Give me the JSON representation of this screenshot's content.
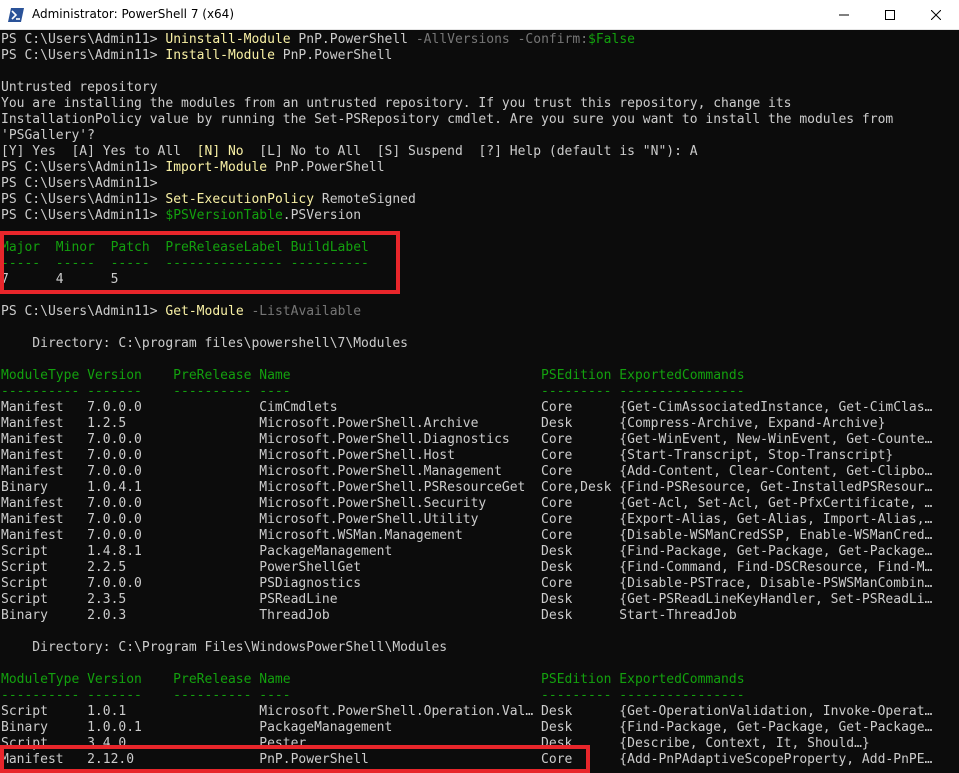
{
  "window": {
    "title": "Administrator: PowerShell 7 (x64)"
  },
  "colors": {
    "background": "#0c0c0c",
    "text": "#cccccc",
    "command": "#f9f1a5",
    "header": "#13a10e",
    "parameter": "#767676",
    "highlight_box": "#e8262b"
  },
  "terminal": {
    "lines": [
      [
        {
          "t": "PS C:\\Users\\Admin11> ",
          "c": "w"
        },
        {
          "t": "Uninstall-Module",
          "c": "y"
        },
        {
          "t": " PnP.PowerShell ",
          "c": "w"
        },
        {
          "t": "-AllVersions -Confirm:",
          "c": "d"
        },
        {
          "t": "$False",
          "c": "g"
        }
      ],
      [
        {
          "t": "PS C:\\Users\\Admin11> ",
          "c": "w"
        },
        {
          "t": "Install-Module",
          "c": "y"
        },
        {
          "t": " PnP.PowerShell",
          "c": "w"
        }
      ],
      [],
      [
        {
          "t": "Untrusted repository",
          "c": "w"
        }
      ],
      [
        {
          "t": "You are installing the modules from an untrusted repository. If you trust this repository, change its",
          "c": "w"
        }
      ],
      [
        {
          "t": "InstallationPolicy value by running the Set-PSRepository cmdlet. Are you sure you want to install the modules from",
          "c": "w"
        }
      ],
      [
        {
          "t": "'PSGallery'?",
          "c": "w"
        }
      ],
      [
        {
          "t": "[Y] Yes  [A] Yes to All  ",
          "c": "w"
        },
        {
          "t": "[N] No",
          "c": "y"
        },
        {
          "t": "  [L] No to All  [S] Suspend  [?] Help (default is \"N\"): A",
          "c": "w"
        }
      ],
      [
        {
          "t": "PS C:\\Users\\Admin11> ",
          "c": "w"
        },
        {
          "t": "Import-Module",
          "c": "y"
        },
        {
          "t": " PnP.PowerShell",
          "c": "w"
        }
      ],
      [
        {
          "t": "PS C:\\Users\\Admin11>",
          "c": "w"
        }
      ],
      [
        {
          "t": "PS C:\\Users\\Admin11> ",
          "c": "w"
        },
        {
          "t": "Set-ExecutionPolicy",
          "c": "y"
        },
        {
          "t": " RemoteSigned",
          "c": "w"
        }
      ],
      [
        {
          "t": "PS C:\\Users\\Admin11> ",
          "c": "w"
        },
        {
          "t": "$PSVersionTable",
          "c": "g"
        },
        {
          "t": ".PSVersion",
          "c": "w"
        }
      ],
      [],
      [
        {
          "t": "Major  Minor  Patch  PreReleaseLabel BuildLabel",
          "c": "g"
        }
      ],
      [
        {
          "t": "-----  -----  -----  --------------- ----------",
          "c": "g"
        }
      ],
      [
        {
          "t": "7      4      5",
          "c": "w"
        }
      ],
      [],
      [
        {
          "t": "PS C:\\Users\\Admin11> ",
          "c": "w"
        },
        {
          "t": "Get-Module",
          "c": "y"
        },
        {
          "t": " -ListAvailable",
          "c": "d"
        }
      ],
      [],
      [
        {
          "t": "    Directory: C:\\program files\\powershell\\7\\Modules",
          "c": "w"
        }
      ],
      [],
      [
        {
          "t": "ModuleType Version    PreRelease Name                                PSEdition ExportedCommands",
          "c": "g"
        }
      ],
      [
        {
          "t": "---------- -------    ---------- ----                                --------- ----------------",
          "c": "g"
        }
      ],
      [
        {
          "t": "Manifest   7.0.0.0               CimCmdlets                          Core      {Get-CimAssociatedInstance, Get-CimClas…",
          "c": "w"
        }
      ],
      [
        {
          "t": "Manifest   1.2.5                 Microsoft.PowerShell.Archive        Desk      {Compress-Archive, Expand-Archive}",
          "c": "w"
        }
      ],
      [
        {
          "t": "Manifest   7.0.0.0               Microsoft.PowerShell.Diagnostics    Core      {Get-WinEvent, New-WinEvent, Get-Counte…",
          "c": "w"
        }
      ],
      [
        {
          "t": "Manifest   7.0.0.0               Microsoft.PowerShell.Host           Core      {Start-Transcript, Stop-Transcript}",
          "c": "w"
        }
      ],
      [
        {
          "t": "Manifest   7.0.0.0               Microsoft.PowerShell.Management     Core      {Add-Content, Clear-Content, Get-Clipbo…",
          "c": "w"
        }
      ],
      [
        {
          "t": "Binary     1.0.4.1               Microsoft.PowerShell.PSResourceGet  Core,Desk {Find-PSResource, Get-InstalledPSResour…",
          "c": "w"
        }
      ],
      [
        {
          "t": "Manifest   7.0.0.0               Microsoft.PowerShell.Security       Core      {Get-Acl, Set-Acl, Get-PfxCertificate, …",
          "c": "w"
        }
      ],
      [
        {
          "t": "Manifest   7.0.0.0               Microsoft.PowerShell.Utility        Core      {Export-Alias, Get-Alias, Import-Alias,…",
          "c": "w"
        }
      ],
      [
        {
          "t": "Manifest   7.0.0.0               Microsoft.WSMan.Management          Core      {Disable-WSManCredSSP, Enable-WSManCred…",
          "c": "w"
        }
      ],
      [
        {
          "t": "Script     1.4.8.1               PackageManagement                   Desk      {Find-Package, Get-Package, Get-Package…",
          "c": "w"
        }
      ],
      [
        {
          "t": "Script     2.2.5                 PowerShellGet                       Desk      {Find-Command, Find-DSCResource, Find-M…",
          "c": "w"
        }
      ],
      [
        {
          "t": "Script     7.0.0.0               PSDiagnostics                       Core      {Disable-PSTrace, Disable-PSWSManCombin…",
          "c": "w"
        }
      ],
      [
        {
          "t": "Script     2.3.5                 PSReadLine                          Desk      {Get-PSReadLineKeyHandler, Set-PSReadLi…",
          "c": "w"
        }
      ],
      [
        {
          "t": "Binary     2.0.3                 ThreadJob                           Desk      Start-ThreadJob",
          "c": "w"
        }
      ],
      [],
      [
        {
          "t": "    Directory: C:\\Program Files\\WindowsPowerShell\\Modules",
          "c": "w"
        }
      ],
      [],
      [
        {
          "t": "ModuleType Version    PreRelease Name                                PSEdition ExportedCommands",
          "c": "g"
        }
      ],
      [
        {
          "t": "---------- -------    ---------- ----                                --------- ----------------",
          "c": "g"
        }
      ],
      [
        {
          "t": "Script     1.0.1                 Microsoft.PowerShell.Operation.Val… Desk      {Get-OperationValidation, Invoke-Operat…",
          "c": "w"
        }
      ],
      [
        {
          "t": "Binary     1.0.0.1               PackageManagement                   Desk      {Find-Package, Get-Package, Get-Package…",
          "c": "w"
        }
      ],
      [
        {
          "t": "Script     3.4.0                 Pester                              Desk      {Describe, Context, It, Should…}",
          "c": "w"
        }
      ],
      [
        {
          "t": "Manifest   2.12.0                PnP.PowerShell                      Core      {Add-PnPAdaptiveScopeProperty, Add-PnPE…",
          "c": "w"
        }
      ]
    ]
  }
}
